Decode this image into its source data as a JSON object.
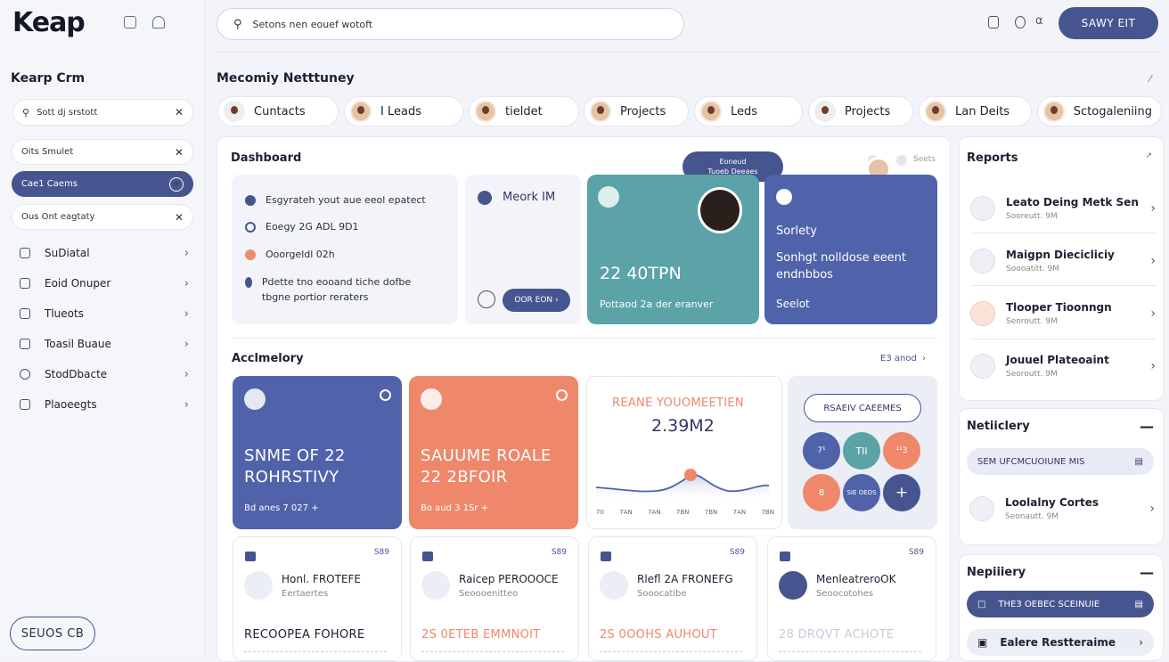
{
  "app": {
    "logo": "Keap",
    "search_placeholder": "Setons nen eouef wotoft",
    "primary_button": "SAWY EIT"
  },
  "sidebar": {
    "title": "Kearp Crm",
    "search_value": "Sott dj srstott",
    "chips": [
      {
        "label": "Oits Smulet",
        "active": false
      },
      {
        "label": "Cae1 Caems",
        "active": true
      },
      {
        "label": "Ous Ont eagtaty",
        "active": false
      }
    ],
    "nav": [
      "SuDiatal",
      "Eoid Onuper",
      "Tlueots",
      "Toasil Buaue",
      "StodDbacte",
      "Plaoeegts"
    ],
    "bottom_button": "SEUOS CB"
  },
  "section": {
    "title": "Mecomiy Netttuney",
    "pills": [
      "Cuntacts",
      "I Leads",
      "tieldet",
      "Projects",
      "Leds",
      "Projects",
      "Lan Deits",
      "Sctogaleniing"
    ]
  },
  "dashboard": {
    "title": "Dashboard",
    "tooltip": [
      "Eoneud",
      "Tuoeb Deeaes"
    ],
    "header_right": "Seets",
    "tasks": [
      {
        "text": "Esgyrateh yout aue eeol epatect",
        "color": "#46558f"
      },
      {
        "text": "Eoegy 2G ADL 9D1",
        "color": "#46558f"
      },
      {
        "text": "Ooorgeldl 02h",
        "color": "#ef8a6d"
      },
      {
        "text": "Pdette tno eooand tiche dofbe tbgne portior reraters",
        "color": "#46558f"
      }
    ],
    "mid_card": {
      "title": "Meork IM",
      "button": "OOR EON"
    },
    "teal_card": {
      "big": "22 40TPN",
      "sub": "Pottaod 2a der eranver"
    },
    "blue_card": {
      "title": "Sorlety",
      "body": "Sonhgt nolldose eeent endnbbos",
      "footer": "Seelot"
    }
  },
  "activity": {
    "title": "Acclmelory",
    "link": "E3 anod",
    "cards": [
      {
        "title": "SNME OF 22 ROHRSTIVY",
        "footer": "Bd anes  7  027  +",
        "color": "#4f62aa"
      },
      {
        "title": "SAUUME ROALE 22 2BFOIR",
        "footer": "Bo aud  3  1Sr  +",
        "color": "#ef876b"
      }
    ],
    "chart": {
      "headline": "REANE YOUOMEETIEN",
      "value": "2.39M2",
      "x_labels": [
        "70",
        "7AN",
        "7AN",
        "7BN",
        "7BN",
        "7AN",
        "7BN"
      ]
    },
    "circles": {
      "button": "RSAEIV CAEEMES",
      "labels": [
        "7¹",
        "TII",
        "¹¹3",
        "8",
        "SIE OEOS",
        "+"
      ]
    },
    "smalls": [
      {
        "badge": "S89",
        "name": "Honl. FROTEFE",
        "sub": "Eertaertes",
        "big": "RECOOPEA FOHORE",
        "color": "#1d2030"
      },
      {
        "badge": "S89",
        "name": "Raicep PEROOOCE",
        "sub": "Seoooenitteo",
        "big": "2S 0ETEB EMMNOIT",
        "color": "#ef876b"
      },
      {
        "badge": "S89",
        "name": "Rlefl 2A FRONEFG",
        "sub": "Sooocatibe",
        "big": "2S 0OOHS AUHOUT",
        "color": "#ef876b"
      },
      {
        "badge": "S89",
        "name": "MenleatreroOK",
        "sub": "Seoocotohes",
        "big": "28 DRQVT ACHOTE",
        "color": "#c8ccd8"
      }
    ]
  },
  "reports": {
    "title": "Reports",
    "items": [
      {
        "name": "Leato Deing Metk Sen",
        "sub": "Sooreutt. 9M"
      },
      {
        "name": "Maigpn Diecicliciy",
        "sub": "Soooatitt. 9M"
      },
      {
        "name": "Tlooper Tioonngn",
        "sub": "Seoroutt. 9M"
      },
      {
        "name": "Jouuel Plateoaint",
        "sub": "Seoroutt. 9M"
      }
    ]
  },
  "netliery": {
    "title": "Netiiclery",
    "bar": "SEM UFCMCUOIUNE MIS",
    "item_name": "Loolalny Cortes",
    "item_sub": "Seonautt. 9M"
  },
  "nepliery": {
    "title": "Nepiiiery",
    "bar": "THE3 OEBEC SCEINUIE",
    "item": "Ealere Restteraime"
  }
}
